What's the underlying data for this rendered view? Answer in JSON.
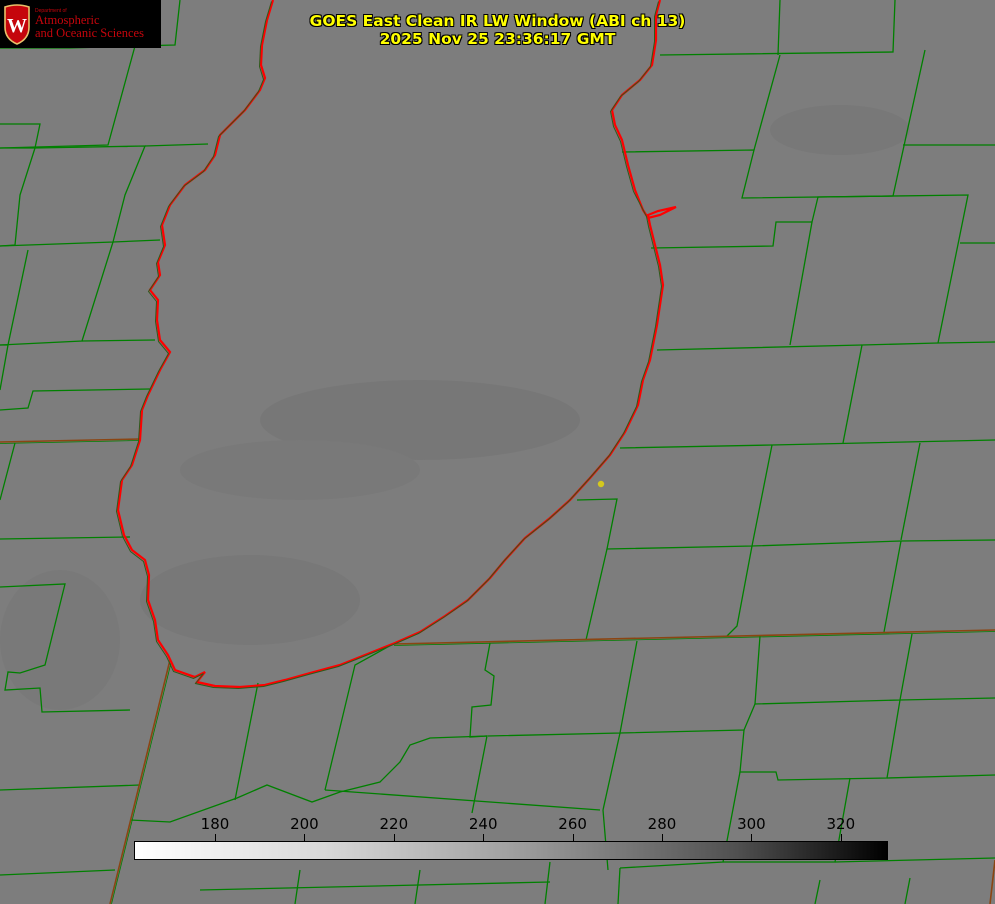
{
  "logo": {
    "department": "Department of",
    "line1": "Atmospheric",
    "line2": "and Oceanic Sciences",
    "crest_letter": "W",
    "crest_icon": "uw-crest-icon",
    "color": "#c5050c"
  },
  "title": {
    "line1": "GOES East Clean IR LW Window (ABI ch 13)",
    "line2": "2025 Nov 25 23:36:17 GMT",
    "color": "#ffff00"
  },
  "colorbar": {
    "ticks": [
      "180",
      "200",
      "220",
      "240",
      "260",
      "280",
      "300",
      "320"
    ],
    "range_start_color": "#ffffff",
    "range_end_color": "#000000"
  },
  "map": {
    "background_color": "#7d7d7d",
    "county_line_color": "#008000",
    "lake_outline_color": "#ff0000",
    "state_line_color": "#8b4513",
    "marker_color": "#d4c81e",
    "features": [
      "lake-michigan-outline",
      "county-boundaries",
      "state-boundaries",
      "location-marker"
    ]
  }
}
